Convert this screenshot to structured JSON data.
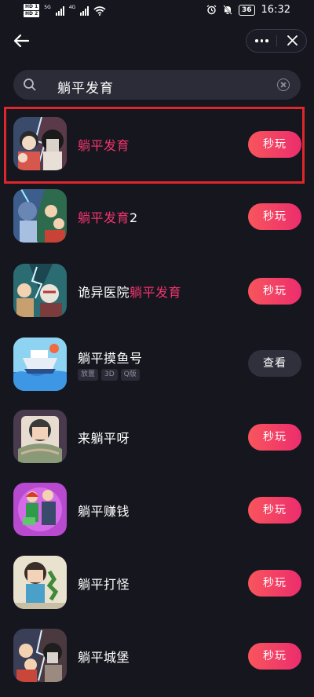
{
  "status_bar": {
    "hd1": "HD 1",
    "hd2": "HD 2",
    "network": "4G",
    "network2": "5G",
    "battery": "36",
    "time": "16:32"
  },
  "search": {
    "value": "躺平发育"
  },
  "results": [
    {
      "title_highlight": "躺平发育",
      "title_rest": "",
      "title_prefix": "",
      "action": "秒玩",
      "tags": []
    },
    {
      "title_highlight": "躺平发育",
      "title_rest": "2",
      "title_prefix": "",
      "action": "秒玩",
      "tags": []
    },
    {
      "title_highlight": "躺平发育",
      "title_rest": "",
      "title_prefix": "诡异医院",
      "action": "秒玩",
      "tags": []
    },
    {
      "title_highlight": "",
      "title_rest": "",
      "title_prefix": "躺平摸鱼号",
      "action": "查看",
      "tags": [
        "放置",
        "3D",
        "Q版"
      ]
    },
    {
      "title_highlight": "",
      "title_rest": "",
      "title_prefix": "来躺平呀",
      "action": "秒玩",
      "tags": []
    },
    {
      "title_highlight": "",
      "title_rest": "",
      "title_prefix": "躺平赚钱",
      "action": "秒玩",
      "tags": []
    },
    {
      "title_highlight": "",
      "title_rest": "",
      "title_prefix": "躺平打怪",
      "action": "秒玩",
      "tags": []
    },
    {
      "title_highlight": "",
      "title_rest": "",
      "title_prefix": "躺平城堡",
      "action": "秒玩",
      "tags": []
    }
  ],
  "colors": {
    "background": "#16161f",
    "highlight": "#f0346c",
    "play_button": "#f23f66",
    "selection_box": "#e0262b"
  }
}
